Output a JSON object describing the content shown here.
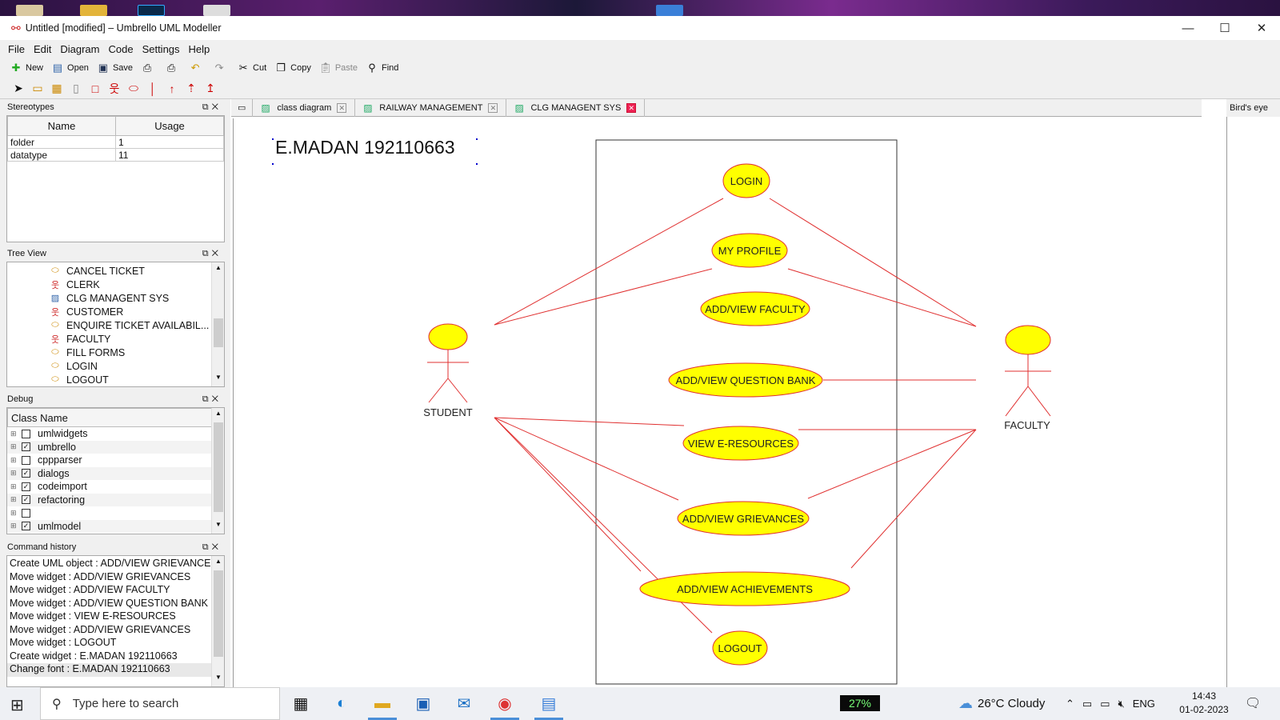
{
  "window": {
    "title": "Untitled [modified] – Umbrello UML Modeller"
  },
  "menu": [
    "File",
    "Edit",
    "Diagram",
    "Code",
    "Settings",
    "Help"
  ],
  "toolbar": {
    "new": "New",
    "open": "Open",
    "save": "Save",
    "cut": "Cut",
    "copy": "Copy",
    "paste": "Paste",
    "find": "Find"
  },
  "stereotypes": {
    "title": "Stereotypes",
    "col_name": "Name",
    "col_usage": "Usage",
    "rows": [
      {
        "name": "folder",
        "usage": "1"
      },
      {
        "name": "datatype",
        "usage": "11"
      }
    ]
  },
  "tree": {
    "title": "Tree View",
    "items": [
      {
        "label": "CANCEL TICKET",
        "icon": "usecase-icon"
      },
      {
        "label": "CLERK",
        "icon": "actor-icon"
      },
      {
        "label": "CLG MANAGENT SYS",
        "icon": "diagram-icon"
      },
      {
        "label": "CUSTOMER",
        "icon": "actor-icon"
      },
      {
        "label": "ENQUIRE TICKET AVAILABIL...",
        "icon": "usecase-icon"
      },
      {
        "label": "FACULTY",
        "icon": "actor-icon"
      },
      {
        "label": "FILL FORMS",
        "icon": "usecase-icon"
      },
      {
        "label": "LOGIN",
        "icon": "usecase-icon"
      },
      {
        "label": "LOGOUT",
        "icon": "usecase-icon"
      }
    ]
  },
  "debug": {
    "title": "Debug",
    "col": "Class Name",
    "rows": [
      {
        "name": "umlwidgets",
        "checked": ""
      },
      {
        "name": "umbrello",
        "checked": "✓"
      },
      {
        "name": "cppparser",
        "checked": ""
      },
      {
        "name": "dialogs",
        "checked": "✓"
      },
      {
        "name": "codeimport",
        "checked": "✓"
      },
      {
        "name": "refactoring",
        "checked": "✓"
      },
      {
        "name": "",
        "checked": ""
      },
      {
        "name": "umlmodel",
        "checked": "✓"
      }
    ]
  },
  "history": {
    "title": "Command history",
    "rows": [
      "Create UML object : ADD/VIEW GRIEVANCES",
      "Move widget : ADD/VIEW GRIEVANCES",
      "Move widget : ADD/VIEW FACULTY",
      "Move widget : ADD/VIEW QUESTION BANK",
      "Move widget : VIEW E-RESOURCES",
      "Move widget : ADD/VIEW GRIEVANCES",
      "Move widget : LOGOUT",
      "Create widget : E.MADAN 192110663",
      "Change font : E.MADAN 192110663"
    ]
  },
  "tabs": [
    {
      "label": "class diagram",
      "active": false
    },
    {
      "label": "RAILWAY MANAGEMENT",
      "active": false
    },
    {
      "label": "CLG MANAGENT SYS",
      "active": true
    }
  ],
  "birdseye": {
    "title": "Bird's eye"
  },
  "diagram": {
    "note": "E.MADAN 192110663",
    "actors": {
      "student": "STUDENT",
      "faculty": "FACULTY"
    },
    "usecases": {
      "login": "LOGIN",
      "profile": "MY PROFILE",
      "faculty": "ADD/VIEW FACULTY",
      "qbank": "ADD/VIEW QUESTION BANK",
      "eres": "VIEW E-RESOURCES",
      "griev": "ADD/VIEW GRIEVANCES",
      "achiev": "ADD/VIEW ACHIEVEMENTS",
      "logout": "LOGOUT"
    },
    "colors": {
      "usecase_fill": "#ffff00",
      "line": "#e03030"
    }
  },
  "taskbar": {
    "search_placeholder": "Type here to search",
    "battery": "27%",
    "weather": "26°C  Cloudy",
    "lang": "ENG",
    "time": "14:43",
    "date": "01-02-2023"
  }
}
